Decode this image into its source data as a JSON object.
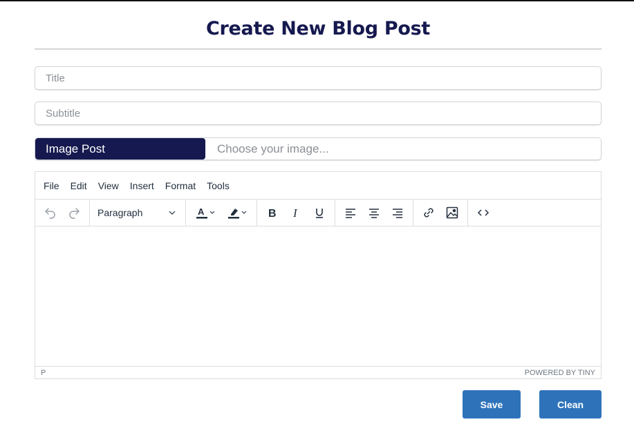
{
  "page": {
    "title": "Create New Blog Post"
  },
  "form": {
    "title_placeholder": "Title",
    "subtitle_placeholder": "Subtitle",
    "image_label": "Image Post",
    "image_choose": "Choose your image..."
  },
  "editor": {
    "menu": [
      "File",
      "Edit",
      "View",
      "Insert",
      "Format",
      "Tools"
    ],
    "block_format": "Paragraph",
    "status_path": "P",
    "branding": "POWERED BY TINY"
  },
  "actions": {
    "save_label": "Save",
    "clean_label": "Clean"
  },
  "colors": {
    "heading": "#16194f",
    "image_label_bg": "#16194f",
    "button": "#2e73ba"
  },
  "icons": [
    "undo-icon",
    "redo-icon",
    "chevron-down-icon",
    "text-color-icon",
    "highlight-color-icon",
    "bold-icon",
    "italic-icon",
    "underline-icon",
    "align-left-icon",
    "align-center-icon",
    "align-right-icon",
    "link-icon",
    "image-icon",
    "source-code-icon"
  ]
}
